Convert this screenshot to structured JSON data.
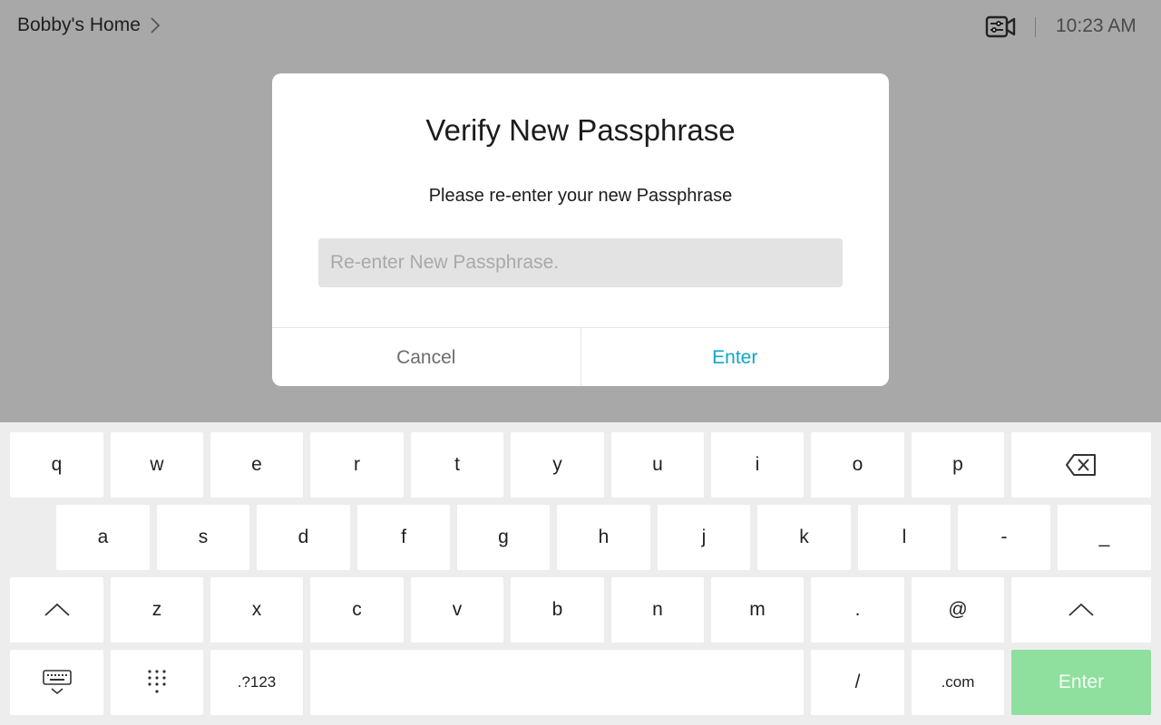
{
  "header": {
    "location": "Bobby's Home",
    "clock": "10:23 AM"
  },
  "dialog": {
    "title": "Verify New Passphrase",
    "subtitle": "Please re-enter your new Passphrase",
    "input_value": "",
    "input_placeholder": "Re-enter New Passphrase.",
    "cancel_label": "Cancel",
    "enter_label": "Enter",
    "accent_color": "#12a5c9"
  },
  "keyboard": {
    "row1": [
      "q",
      "w",
      "e",
      "r",
      "t",
      "y",
      "u",
      "i",
      "o",
      "p"
    ],
    "row2": [
      "a",
      "s",
      "d",
      "f",
      "g",
      "h",
      "j",
      "k",
      "l",
      "-",
      "_"
    ],
    "row3": [
      "z",
      "x",
      "c",
      "v",
      "b",
      "n",
      "m",
      ".",
      "@"
    ],
    "row4": {
      "symbols_label": ".?123",
      "slash_label": "/",
      "dotcom_label": ".com",
      "enter_label": "Enter",
      "enter_color": "#8fdf9f"
    },
    "icons": [
      "backspace-icon",
      "shift-icon",
      "hide-keyboard-icon",
      "keypad-icon"
    ]
  }
}
